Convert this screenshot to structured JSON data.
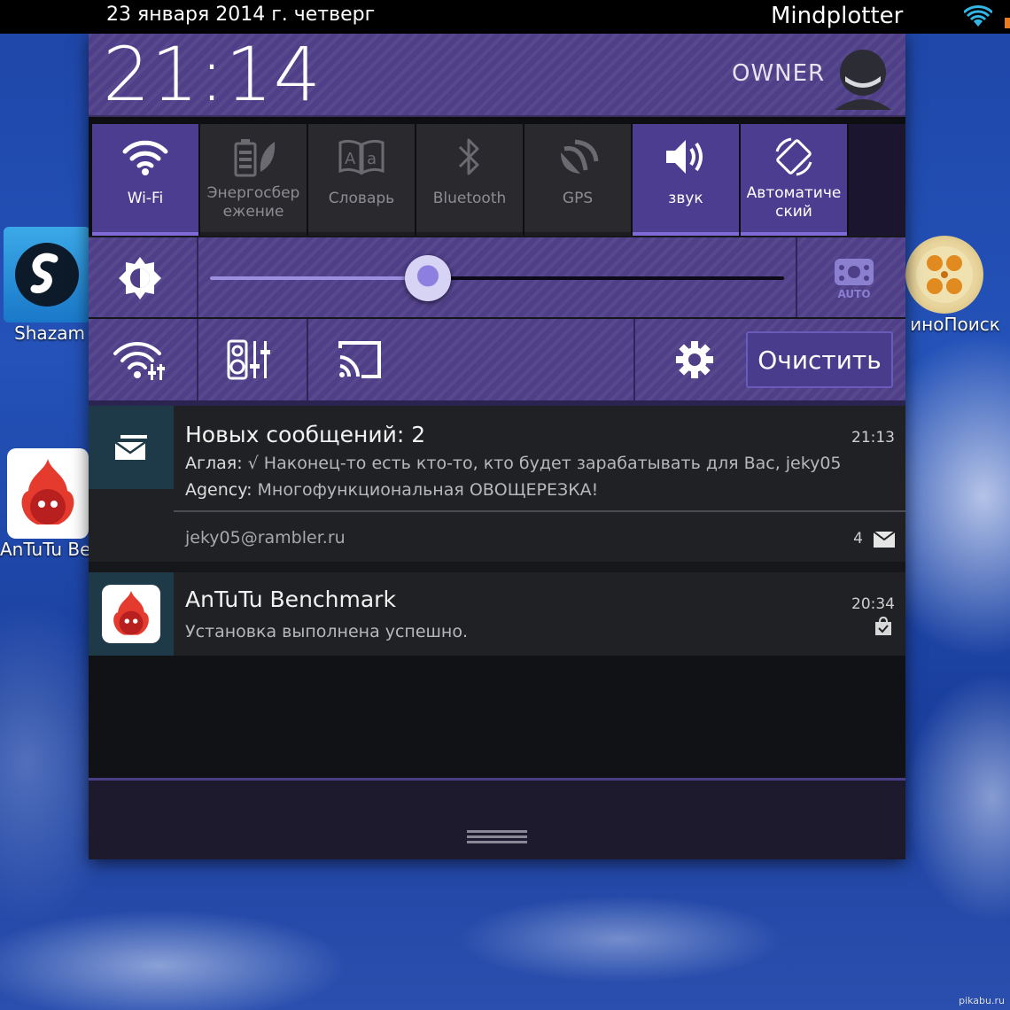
{
  "status_bar": {
    "date": "23 января 2014 г. четверг",
    "carrier": "Mindplotter"
  },
  "home_apps": {
    "shazam": "Shazam",
    "antutu": "AnTuTu Ber",
    "kinopoisk": "иноПоиск"
  },
  "header": {
    "clock": "21:14",
    "owner": "OWNER"
  },
  "quick_tiles": [
    {
      "label": "Wi-Fi",
      "icon": "wifi-icon",
      "on": true
    },
    {
      "label": "Энергосбер ежение",
      "icon": "battery-saver-icon",
      "on": false
    },
    {
      "label": "Словарь",
      "icon": "dictionary-icon",
      "on": false
    },
    {
      "label": "Bluetooth",
      "icon": "bluetooth-icon",
      "on": false
    },
    {
      "label": "GPS",
      "icon": "gps-icon",
      "on": false
    },
    {
      "label": "звук",
      "icon": "sound-icon",
      "on": true
    },
    {
      "label": "Автоматиче ский",
      "icon": "auto-rotate-icon",
      "on": true
    }
  ],
  "brightness": {
    "level_fraction": 0.38,
    "auto_label": "AUTO"
  },
  "tools": {
    "clear_label": "Очистить"
  },
  "notifications": {
    "messages": {
      "title": "Новых сообщений: 2",
      "time": "21:13",
      "line1_sender": "Аглая:",
      "line1_text": " √ Наконец-то есть кто-то, кто будет зарабатывать для Вас, jeky05",
      "line2_sender": "Agency:",
      "line2_text": " Многофункциональная ОВОЩЕРЕЗКА!",
      "account": "jeky05@rambler.ru",
      "count": "4"
    },
    "antutu": {
      "title": "AnTuTu Benchmark",
      "time": "20:34",
      "text": "Установка выполнена успешно."
    }
  },
  "watermark": "pikabu.ru",
  "colors": {
    "panel_accent": "#4f3e88",
    "tile_on": "#4c3d90",
    "tile_off": "#2a2a2e"
  }
}
